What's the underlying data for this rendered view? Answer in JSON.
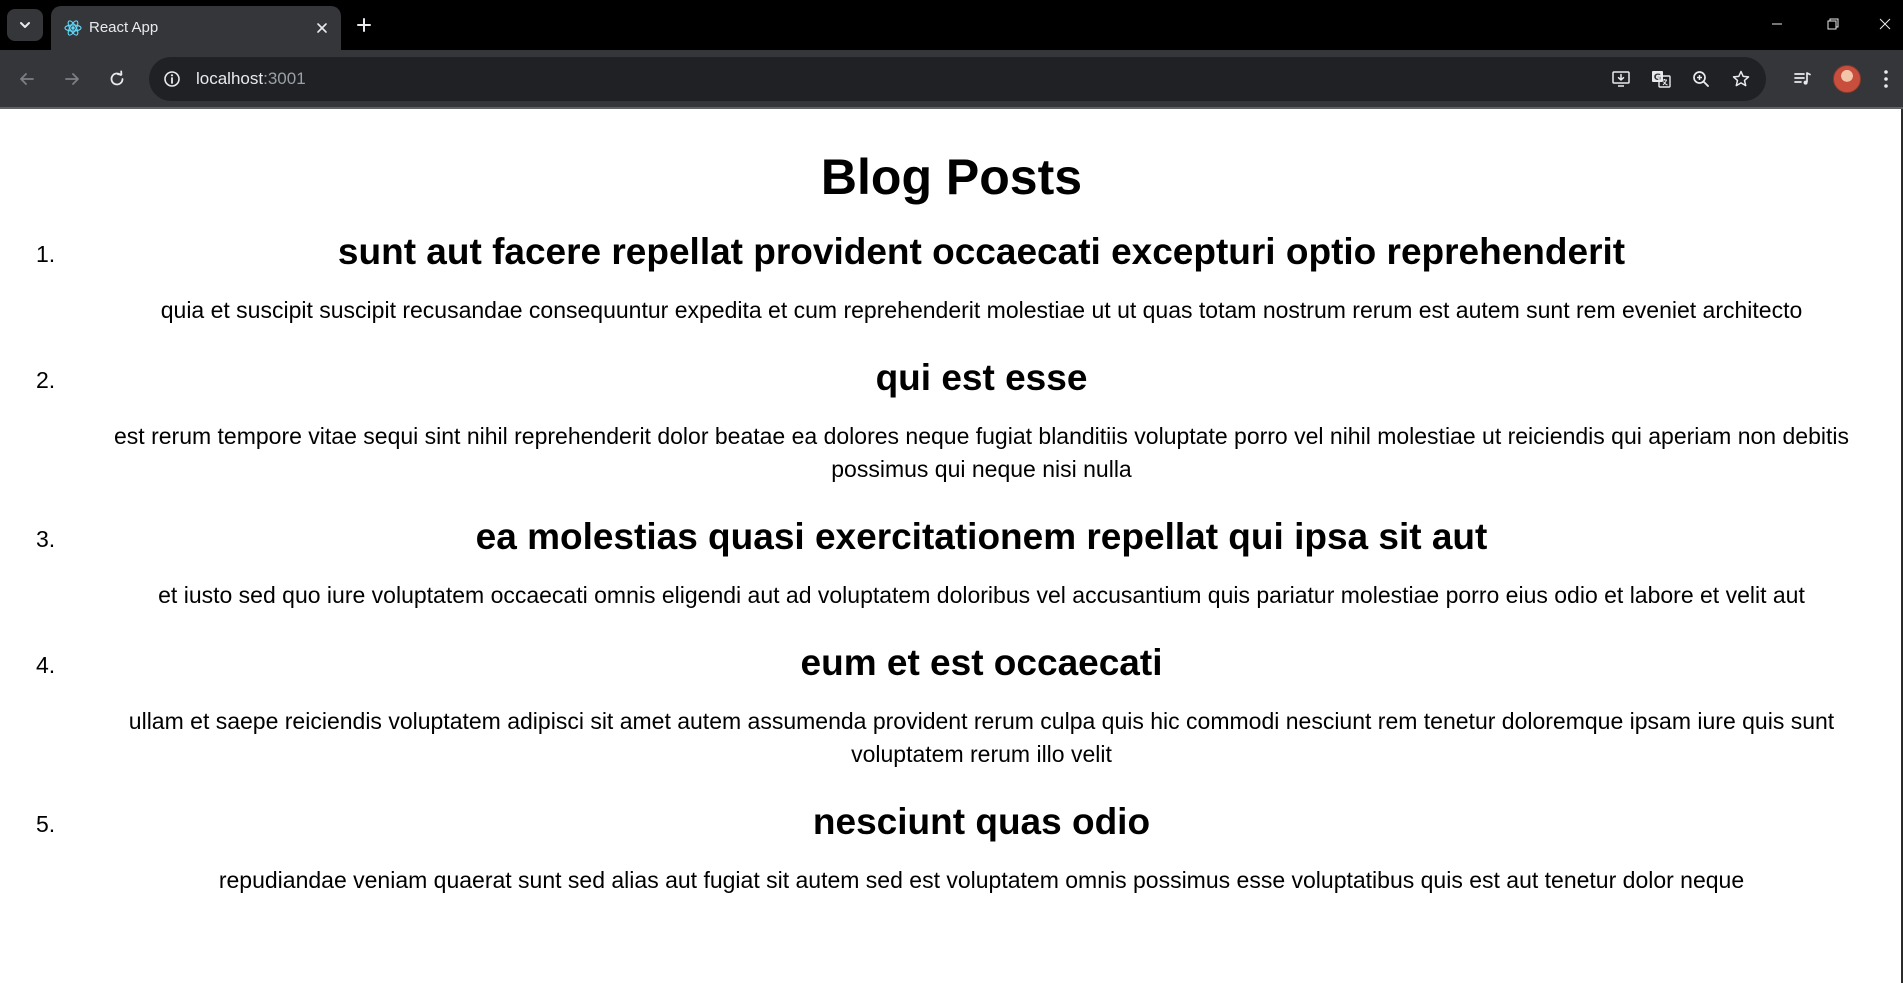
{
  "browser": {
    "tab": {
      "title": "React App"
    },
    "address_bar": {
      "host": "localhost",
      "port": ":3001"
    }
  },
  "page": {
    "heading": "Blog Posts",
    "posts": [
      {
        "number": "1.",
        "title": "sunt aut facere repellat provident occaecati excepturi optio reprehenderit",
        "body": "quia et suscipit suscipit recusandae consequuntur expedita et cum reprehenderit molestiae ut ut quas totam nostrum rerum est autem sunt rem eveniet architecto"
      },
      {
        "number": "2.",
        "title": "qui est esse",
        "body": "est rerum tempore vitae sequi sint nihil reprehenderit dolor beatae ea dolores neque fugiat blanditiis voluptate porro vel nihil molestiae ut reiciendis qui aperiam non debitis possimus qui neque nisi nulla"
      },
      {
        "number": "3.",
        "title": "ea molestias quasi exercitationem repellat qui ipsa sit aut",
        "body": "et iusto sed quo iure voluptatem occaecati omnis eligendi aut ad voluptatem doloribus vel accusantium quis pariatur molestiae porro eius odio et labore et velit aut"
      },
      {
        "number": "4.",
        "title": "eum et est occaecati",
        "body": "ullam et saepe reiciendis voluptatem adipisci sit amet autem assumenda provident rerum culpa quis hic commodi nesciunt rem tenetur doloremque ipsam iure quis sunt voluptatem rerum illo velit"
      },
      {
        "number": "5.",
        "title": "nesciunt quas odio",
        "body": "repudiandae veniam quaerat sunt sed alias aut fugiat sit autem sed est voluptatem omnis possimus esse voluptatibus quis est aut tenetur dolor neque"
      }
    ]
  },
  "colors": {
    "tabstrip_bg": "#000000",
    "toolbar_bg": "#35363a",
    "omnibox_bg": "#202124",
    "text_light": "#e8eaed",
    "text_dim": "#9aa0a6"
  }
}
